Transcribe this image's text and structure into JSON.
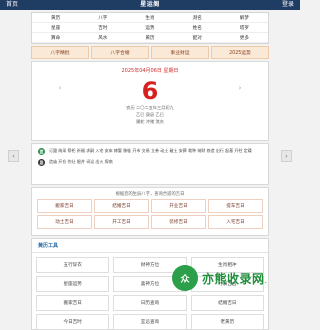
{
  "topbar": {
    "left_label": "首页",
    "logo_text": "星运阁",
    "right_label": "登录"
  },
  "nav_items": [
    "黄历",
    "八字",
    "生肖",
    "测名",
    "解梦",
    "星座",
    "吉时",
    "运势",
    "姓名",
    "塔罗",
    "算命",
    "风水",
    "黄历",
    "配对",
    "更多"
  ],
  "promo_items": [
    "八字精批",
    "八字合婚",
    "事业财运",
    "2025运势"
  ],
  "date_card": {
    "header": "2025年04月06日 星期日",
    "day": "6",
    "sub1": "农历 二〇二五年三月初九",
    "sub2": "乙巳 庚辰 乙巳",
    "sub3": "属蛇 冲猪 煞东"
  },
  "yiji": {
    "yi_icon": "宜",
    "ji_icon": "忌",
    "yi_text": "订盟 纳采 祭祀 祈福 求嗣 入宅 安床 嫁娶 移徙 开市 交易 立券 动土 破土 安葬 栽种 纳财 修造 出行 起基 开柱 定磉",
    "ji_text": "造庙 开仓 作灶 掘井 词讼 出火 探病"
  },
  "query": {
    "title": "根据您的生辰八字，查询合适的吉日",
    "items": [
      "搬家吉日",
      "结婚吉日",
      "开业吉日",
      "提车吉日",
      "动土吉日",
      "开工吉日",
      "装修吉日",
      "入宅吉日"
    ]
  },
  "tools": {
    "title": "黄历工具",
    "items": [
      "五行穿衣",
      "财神方位",
      "生肖相冲",
      "星座运势",
      "喜神方位",
      "时辰吉凶",
      "搬家吉日",
      "日历查询",
      "结婚吉日",
      "今日吉时",
      "宜忌查询",
      "老黄历"
    ]
  },
  "watermark": {
    "icon": "众",
    "text": "亦熊收录网",
    "dot": "."
  }
}
